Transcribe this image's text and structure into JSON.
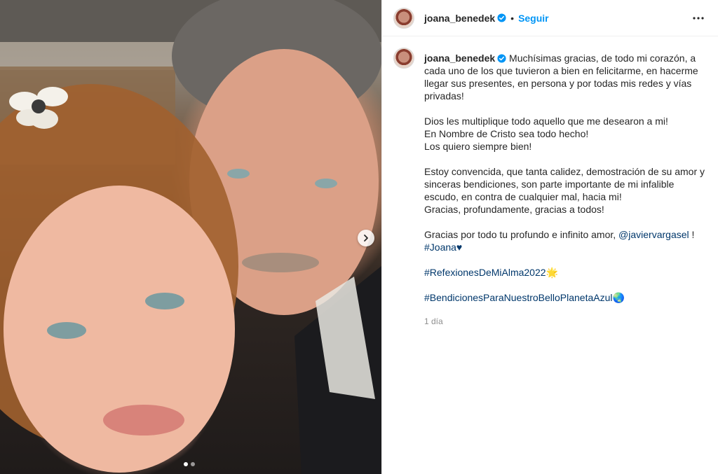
{
  "post": {
    "media": {
      "carousel_next_icon": "chevron-right-icon",
      "dots": [
        true,
        false
      ]
    },
    "header": {
      "username": "joana_benedek",
      "separator": "•",
      "follow_label": "Seguir",
      "more_icon": "more-horizontal-icon"
    },
    "caption": {
      "username": "joana_benedek",
      "paragraph1": "Muchísimas gracias, de todo mi corazón, a cada uno de los que tuvieron a bien en felicitarme, en hacerme llegar sus presentes, en persona y por todas mis redes y vías privadas!",
      "paragraph2": [
        "Dios les multiplique todo aquello que me desearon a mi!",
        "En Nombre de Cristo sea todo hecho!",
        "Los quiero siempre bien!"
      ],
      "paragraph3": [
        "Estoy convencida, que tanta calidez, demostración de su amor y sinceras bendiciones, son parte importante de mi infalible escudo, en contra de cualquier mal, hacia mi!",
        "Gracias, profundamente, gracias a todos!"
      ],
      "paragraph4_text": "Gracias por todo tu profundo e infinito amor, ",
      "mention": "@javiervargasel",
      "paragraph4_end": " !",
      "hashtag_joana": "#Joana♥",
      "hashtag_reflexiones": "#RefexionesDeMiAlma2022🌟",
      "hashtag_bendiciones": "#BendicionesParaNuestroBelloPlanetaAzul🌏",
      "timestamp": "1 día"
    }
  }
}
